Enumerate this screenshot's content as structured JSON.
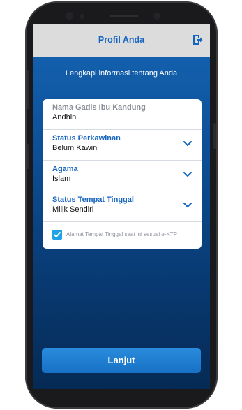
{
  "header": {
    "title": "Profil Anda",
    "logout_icon": "logout-icon"
  },
  "subtitle": "Lengkapi informasi tentang Anda",
  "form": {
    "fields": [
      {
        "label": "Nama Gadis Ibu Kandung",
        "value": "Andhini",
        "dropdown": false
      },
      {
        "label": "Status Perkawinan",
        "value": "Belum Kawin",
        "dropdown": true
      },
      {
        "label": "Agama",
        "value": "Islam",
        "dropdown": true
      },
      {
        "label": "Status Tempat Tinggal",
        "value": "Milik Sendiri",
        "dropdown": true
      }
    ],
    "checkbox": {
      "label": "Alamat Tempat Tinggal saat ini sesuai e-KTP",
      "checked": true
    }
  },
  "submit_label": "Lanjut",
  "colors": {
    "accent": "#1565c0",
    "background_top": "#1565b5",
    "background_bottom": "#062a55",
    "checkbox": "#1ea1e6",
    "button": "#1771c4"
  }
}
